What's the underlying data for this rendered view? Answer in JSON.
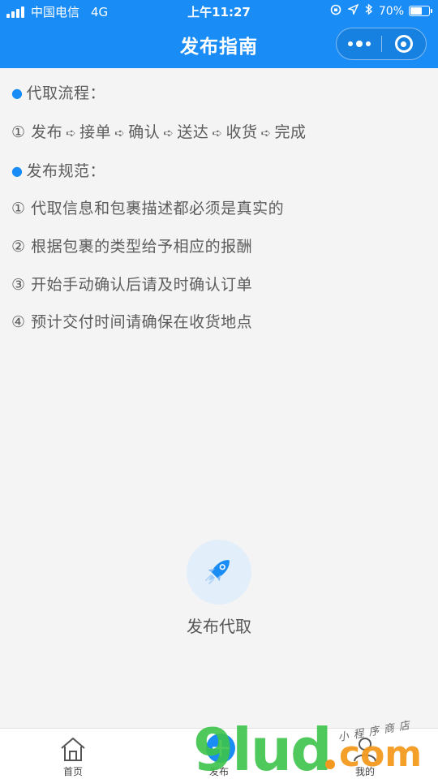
{
  "status_bar": {
    "carrier": "中国电信",
    "network": "4G",
    "time": "上午11:27",
    "battery": "70%",
    "battery_level": 0.7
  },
  "nav": {
    "title": "发布指南"
  },
  "guide": {
    "process_heading": "代取流程：",
    "process_steps": [
      "① 发布",
      "接单",
      "确认",
      "送达",
      "收货",
      "完成"
    ],
    "rules_heading": "发布规范：",
    "rules": [
      "① 代取信息和包裹描述都必须是真实的",
      "② 根据包裹的类型给予相应的报酬",
      "③ 开始手动确认后请及时确认订单",
      "④ 预计交付时间请确保在收货地点"
    ]
  },
  "publish": {
    "label": "发布代取"
  },
  "tabbar": {
    "items": [
      {
        "label": "首页",
        "icon": "home-icon"
      },
      {
        "label": "发布",
        "icon": "plus-icon"
      },
      {
        "label": "我的",
        "icon": "user-icon"
      }
    ]
  },
  "watermark": {
    "main": "9lud",
    "suffix": "com",
    "tagline": "小程序商店"
  },
  "colors": {
    "primary": "#1a8cf5",
    "background": "#f4f4f4",
    "watermark_green": "#3cc44a",
    "watermark_orange": "#f39a1e"
  }
}
